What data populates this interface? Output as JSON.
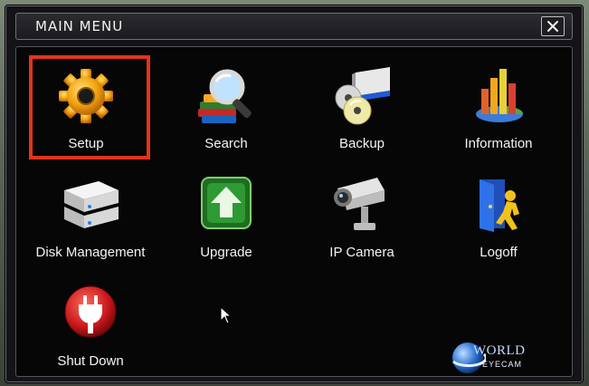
{
  "window": {
    "title": "MAIN MENU",
    "close_glyph": "✕"
  },
  "menu": {
    "items": [
      {
        "label": "Setup",
        "icon": "gear-icon",
        "selected": true
      },
      {
        "label": "Search",
        "icon": "magnifier-books-icon",
        "selected": false
      },
      {
        "label": "Backup",
        "icon": "backup-discs-icon",
        "selected": false
      },
      {
        "label": "Information",
        "icon": "bar-chart-icon",
        "selected": false
      },
      {
        "label": "Disk Management",
        "icon": "hard-disk-icon",
        "selected": false
      },
      {
        "label": "Upgrade",
        "icon": "upgrade-arrow-icon",
        "selected": false
      },
      {
        "label": "IP Camera",
        "icon": "camera-icon",
        "selected": false
      },
      {
        "label": "Logoff",
        "icon": "logoff-door-icon",
        "selected": false
      },
      {
        "label": "Shut Down",
        "icon": "power-plug-icon",
        "selected": false
      }
    ]
  },
  "logo": {
    "world": "WORLD",
    "eyecam": "EYECAM"
  },
  "colors": {
    "selection": "#e2341a",
    "background": "#060606",
    "text": "#f4f4f4"
  }
}
